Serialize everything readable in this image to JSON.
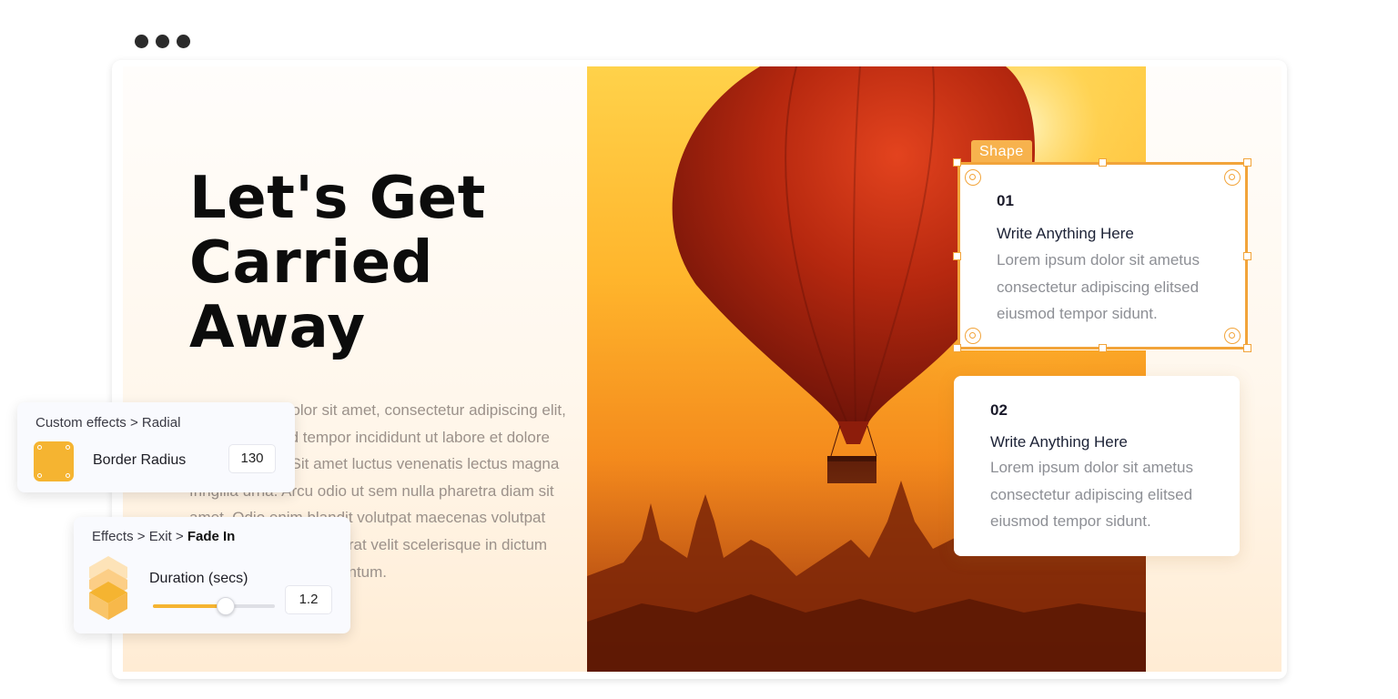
{
  "window": {
    "controls": [
      "dot",
      "dot",
      "dot"
    ]
  },
  "slide": {
    "headline": [
      "Let's Get",
      "Carried",
      "Away"
    ],
    "body": "Lorem ipsum dolor sit amet, consectetur adipiscing elit, sed do eiusmod tempor incididunt ut labore et dolore magna aliqua. Sit amet luctus venenatis lectus magna fringilla urna. Arcu odio ut sem nulla pharetra diam sit amet. Odio enim blandit volutpat maecenas volutpat blandit aliquam etiam erat velit scelerisque in dictum non. Viverra sed elementum.",
    "image": "hot-air-balloon-at-sunset",
    "cards": [
      {
        "number": "01",
        "title": "Write Anything Here",
        "description": "Lorem ipsum dolor sit ametus consectetur adipiscing elitsed eiusmod tempor sidunt."
      },
      {
        "number": "02",
        "title": "Write Anything Here",
        "description": "Lorem ipsum dolor sit ametus consectetur adipiscing elitsed eiusmod tempor sidunt."
      }
    ],
    "selection_tag": "Shape"
  },
  "panels": {
    "custom_effects": {
      "breadcrumb": [
        "Custom effects",
        "Radial"
      ],
      "label": "Border Radius",
      "value": "130",
      "swatch_color": "#f5b431"
    },
    "exit_effects": {
      "breadcrumb": [
        "Effects",
        "Exit",
        "Fade In"
      ],
      "label": "Duration (secs)",
      "value": "1.2",
      "slider_fraction": 0.6
    }
  },
  "colors": {
    "accent": "#f2a43a",
    "swatch": "#f5b431"
  }
}
